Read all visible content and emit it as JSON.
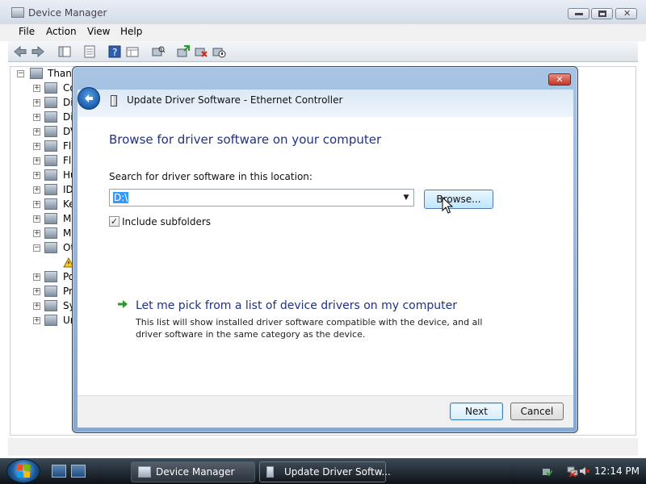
{
  "device_manager": {
    "title": "Device Manager",
    "menu": [
      "File",
      "Action",
      "View",
      "Help"
    ],
    "tree": {
      "root_label": "Thany",
      "categories": [
        "Co",
        "Di",
        "Di",
        "DV",
        "Fl",
        "Fl",
        "Hu",
        "ID",
        "Ke",
        "M",
        "M",
        "Ot",
        "",
        "Po",
        "Pr",
        "Sy",
        "Ur"
      ]
    }
  },
  "dialog": {
    "title": "Update Driver Software - Ethernet Controller",
    "heading": "Browse for driver software on your computer",
    "search_label": "Search for driver software in this location:",
    "path_value": "D:\\",
    "browse_label": "Browse...",
    "include_subfolders_label": "Include subfolders",
    "include_subfolders_checked": true,
    "pick_link": "Let me pick from a list of device drivers on my computer",
    "pick_description": "This list will show installed driver software compatible with the device, and all driver software in the same category as the device.",
    "next_label": "Next",
    "cancel_label": "Cancel",
    "close_glyph": "✕"
  },
  "taskbar": {
    "tasks": [
      "Device Manager",
      "Update Driver Softw..."
    ],
    "clock": "12:14 PM"
  },
  "colors": {
    "link_blue": "#1e3287",
    "green_arrow": "#2b9a2b",
    "selection": "#3399ff"
  }
}
